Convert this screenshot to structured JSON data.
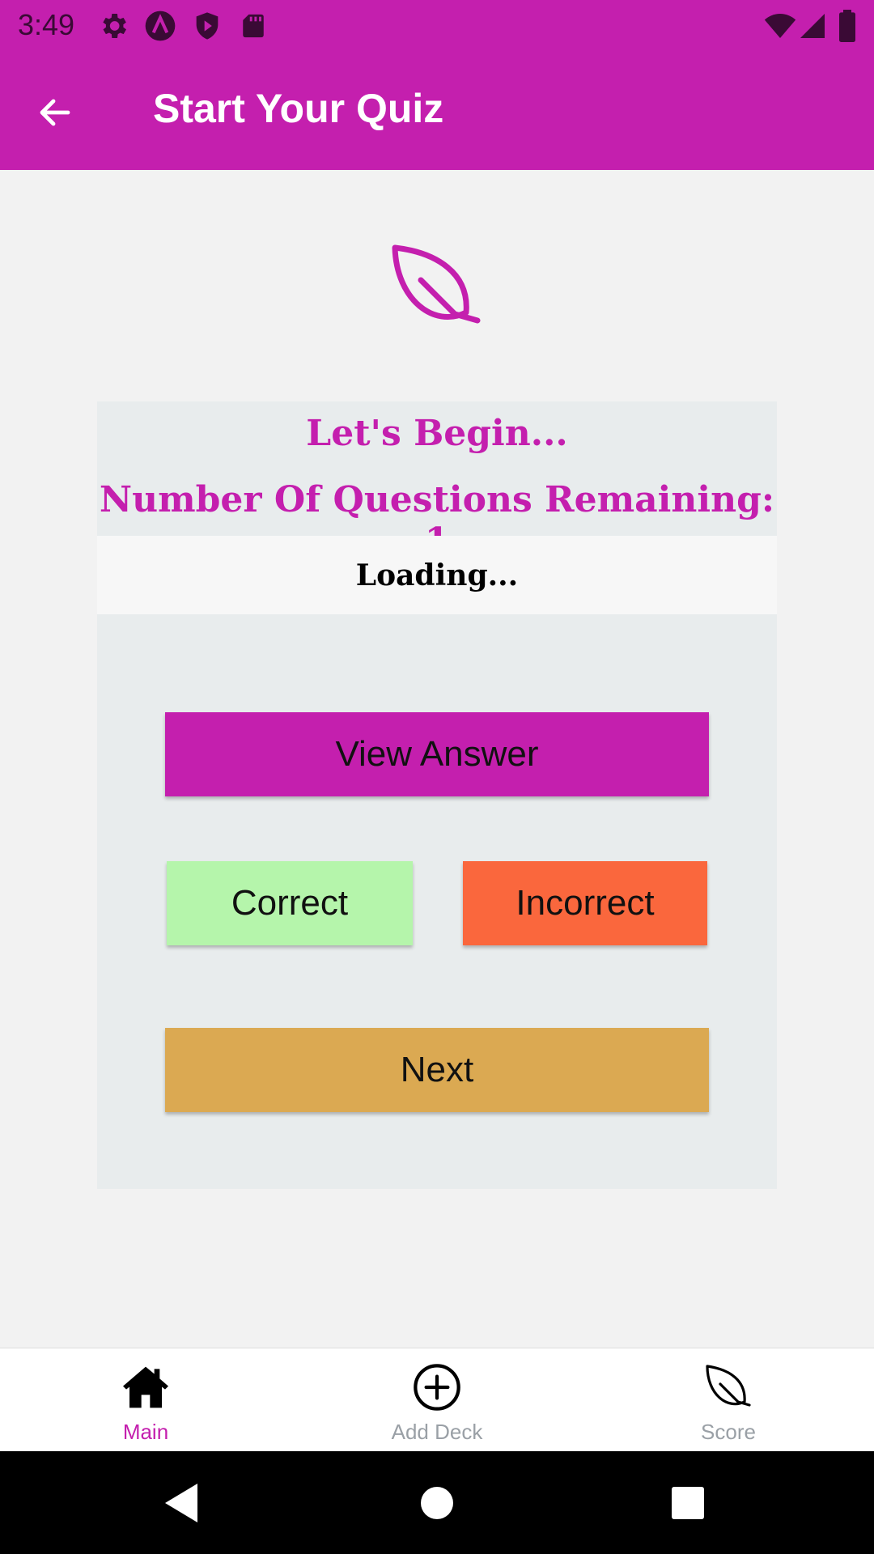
{
  "status_bar": {
    "time": "3:49",
    "background": "#c41fae",
    "left_icons": [
      "gear-icon",
      "app-a-icon",
      "shield-play-icon",
      "sd-card-icon"
    ],
    "right_icons": [
      "wifi-icon",
      "signal-icon",
      "battery-icon"
    ]
  },
  "app_bar": {
    "title": "Start Your Quiz",
    "back_icon": "arrow-left-icon",
    "background": "#c41fae"
  },
  "logo": {
    "icon": "leaf-icon",
    "color": "#c41fae"
  },
  "quiz": {
    "title": "Let's Begin...",
    "remaining_text": "Number Of Questions Remaining: 1",
    "question_text": "Loading...",
    "buttons": {
      "view_answer": "View Answer",
      "correct": "Correct",
      "incorrect": "Incorrect",
      "next": "Next"
    },
    "colors": {
      "view_answer": "#c41fae",
      "correct": "#b5f5ab",
      "incorrect": "#fa673d",
      "next": "#dba952"
    }
  },
  "bottom_nav": {
    "items": [
      {
        "label": "Main",
        "icon": "home-icon",
        "active": true
      },
      {
        "label": "Add Deck",
        "icon": "plus-circle-icon",
        "active": false
      },
      {
        "label": "Score",
        "icon": "leaf-icon",
        "active": false
      }
    ],
    "active_color": "#c41fae"
  },
  "system_nav": {
    "buttons": [
      "back-triangle-icon",
      "home-circle-icon",
      "recents-square-icon"
    ]
  }
}
